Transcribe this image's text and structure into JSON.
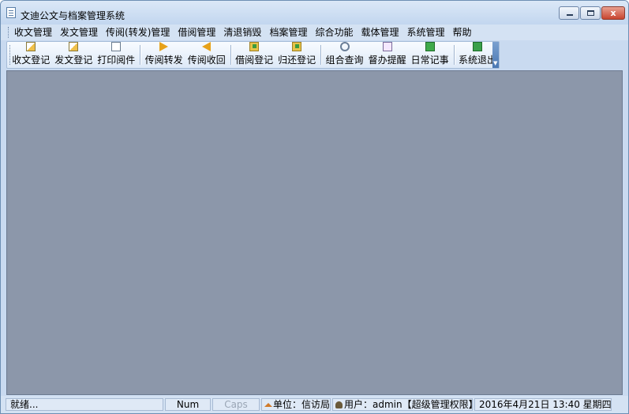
{
  "window": {
    "title": "文迪公文与档案管理系统",
    "minimize_icon": "minimize-icon",
    "maximize_icon": "maximize-icon",
    "close_icon": "close-icon",
    "close_glyph": "x"
  },
  "menu": [
    "收文管理",
    "发文管理",
    "传阅(转发)管理",
    "借阅管理",
    "清退销毁",
    "档案管理",
    "综合功能",
    "载体管理",
    "系统管理",
    "帮助"
  ],
  "toolbar": {
    "groups": [
      [
        {
          "label": "收文登记",
          "icon": "pen-icon"
        },
        {
          "label": "发文登记",
          "icon": "pen-icon"
        },
        {
          "label": "打印阅件",
          "icon": "document-icon"
        }
      ],
      [
        {
          "label": "传阅转发",
          "icon": "arrow-right-icon"
        },
        {
          "label": "传阅收回",
          "icon": "arrow-left-icon"
        }
      ],
      [
        {
          "label": "借阅登记",
          "icon": "folder-icon"
        },
        {
          "label": "归还登记",
          "icon": "folder-icon"
        }
      ],
      [
        {
          "label": "组合查询",
          "icon": "search-icon"
        },
        {
          "label": "督办提醒",
          "icon": "reminder-icon"
        },
        {
          "label": "日常记事",
          "icon": "notebook-icon"
        }
      ],
      [
        {
          "label": "系统退出",
          "icon": "exit-icon"
        }
      ]
    ]
  },
  "status": {
    "ready": "就绪...",
    "num": "Num",
    "caps": "Caps",
    "unit": "单位：信访局",
    "user": "用户：admin【超级管理权限】",
    "datetime": "2016年4月21日 13:40 星期四"
  }
}
